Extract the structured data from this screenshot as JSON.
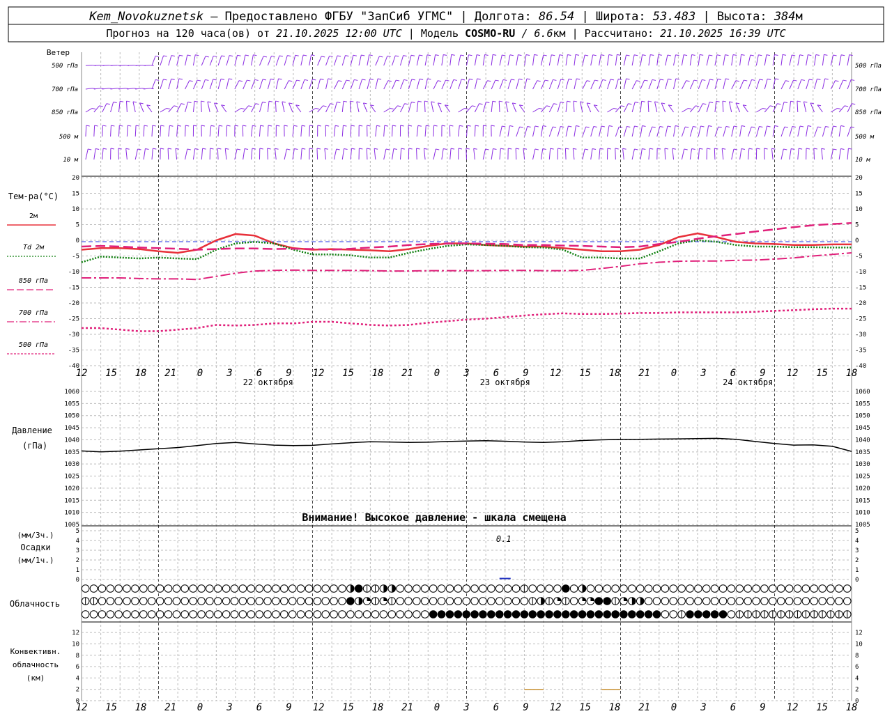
{
  "header": {
    "line1": {
      "station": "Kem_Novokuznetsk",
      "provider": " — Предоставлено ФГБУ \"ЗапСиб УГМС\" | Долгота: ",
      "lon": "86.54",
      "lat_label": " | Широта: ",
      "lat": "53.483",
      "alt_label": " | Высота: ",
      "alt": "384",
      "alt_unit": "м"
    },
    "line2": {
      "forecast": "Прогноз на 120 часа(ов) от ",
      "start": "21.10.2025 12:00 UTC",
      "model_label": " | Модель ",
      "model": "COSMO-RU",
      "res": " / 6.6",
      "res_unit": "км",
      "calc_label": " | Рассчитано: ",
      "calc": "21.10.2025 16:39 UTC"
    }
  },
  "wind_panel": {
    "title": "Ветер",
    "levels": [
      "500 гПа",
      "700 гПа",
      "850 гПа",
      "500 м",
      "10  м"
    ],
    "colors": {
      "barb": "#8a2be2"
    }
  },
  "temp_panel": {
    "title": "Тем-ра(°C)",
    "legend": [
      {
        "label": "2м",
        "color": "#e8303a",
        "style": "solid"
      },
      {
        "label": "Td  2м",
        "color": "#108010",
        "style": "dot"
      },
      {
        "label": "850 гПа",
        "color": "#e0207a",
        "style": "dash"
      },
      {
        "label": "700 гПа",
        "color": "#e0207a",
        "style": "dashdot"
      },
      {
        "label": "500 гПа",
        "color": "#e0207a",
        "style": "fine"
      }
    ],
    "ticks": [
      "20",
      "15",
      "10",
      "5",
      "0",
      "-5",
      "-10",
      "-15",
      "-20",
      "-25",
      "-30",
      "-35",
      "-40"
    ]
  },
  "time_axis": {
    "hours": [
      "12",
      "15",
      "18",
      "21",
      "0",
      "3",
      "6",
      "9",
      "12",
      "15",
      "18",
      "21",
      "0",
      "3",
      "6",
      "9",
      "12",
      "15",
      "18",
      "21",
      "0",
      "3",
      "6",
      "9",
      "12",
      "15",
      "18"
    ],
    "dates": [
      "22 октября",
      "23 октября",
      "24 октября"
    ]
  },
  "pressure_panel": {
    "title": "Давление",
    "unit": "(гПа)",
    "ticks": [
      "1060",
      "1055",
      "1050",
      "1045",
      "1040",
      "1035",
      "1030",
      "1025",
      "1020",
      "1015",
      "1010",
      "1005"
    ],
    "warning": "Внимание! Высокое давление - шкала смещена"
  },
  "precip_panel": {
    "unit3": "(мм/3ч.)",
    "title": "Осадки",
    "unit1": "(мм/1ч.)",
    "ticks": [
      "5",
      "4",
      "3",
      "2",
      "1",
      "0"
    ],
    "annotation": "0.1"
  },
  "cloud_panel": {
    "title": "Облачность",
    "rows": [
      "00000000000000000000000000000000341133000000000000000100004030000000000000000000000000000000000000000000000000000000000000000001023",
      "11000000000000000000000000000000432121000000000000000013121022441233000000000000000000000000000000000000000000000000000000001111110",
      "00000000000000000000000000000000000000000044444444444444444444444444440014444401111111111111111111111111111111111111111111111111144441"
    ]
  },
  "conv_panel": {
    "title1": "Конвективн.",
    "title2": "облачность",
    "unit": "(км)",
    "ticks": [
      "12",
      "10",
      "8",
      "6",
      "4",
      "2",
      "0"
    ]
  },
  "chart_data": [
    {
      "type": "line",
      "title": "Тем-ра(°C)",
      "x_hours": [
        0,
        3,
        6,
        9,
        12,
        15,
        18,
        21,
        24,
        27,
        30,
        33,
        36,
        39,
        42,
        45,
        48,
        51,
        54,
        57,
        60,
        63,
        66,
        69,
        72,
        75,
        78,
        81,
        84,
        87,
        90,
        93,
        96,
        99,
        102,
        105,
        108,
        111,
        114,
        117,
        120
      ],
      "ylim": [
        -40,
        20
      ],
      "series": [
        {
          "name": "2м",
          "values": [
            -3,
            -2.5,
            -2.5,
            -2.8,
            -3.5,
            -4,
            -3,
            0,
            2,
            1.5,
            -1,
            -2.5,
            -3,
            -2.8,
            -3,
            -3.2,
            -3.5,
            -2.8,
            -1.8,
            -1,
            -1,
            -1.5,
            -1.8,
            -2,
            -2,
            -2.5,
            -3,
            -3.5,
            -3.5,
            -3,
            -1.5,
            1,
            2.2,
            1,
            -0.5,
            -1,
            -1.2,
            -1.5,
            -1.5,
            -1.3,
            -1.3
          ]
        },
        {
          "name": "Td 2м",
          "values": [
            -7,
            -5.2,
            -5.5,
            -5.8,
            -5.5,
            -5.8,
            -6,
            -3,
            -1,
            -0.5,
            -1,
            -3,
            -4.5,
            -4.5,
            -4.8,
            -5.5,
            -5.5,
            -4,
            -2.8,
            -1.8,
            -1.3,
            -1.5,
            -1.8,
            -2.2,
            -2.3,
            -3,
            -5.5,
            -5.5,
            -5.8,
            -5.8,
            -3.5,
            -1,
            0,
            -0.5,
            -1.5,
            -2,
            -2,
            -2.2,
            -2.2,
            -2.3,
            -2.3
          ]
        },
        {
          "name": "850 гПа",
          "values": [
            -2,
            -1.8,
            -2,
            -2.3,
            -2.5,
            -2.7,
            -3,
            -2.8,
            -2.6,
            -2.6,
            -2.8,
            -2.7,
            -2.8,
            -3,
            -2.7,
            -2.3,
            -2,
            -1.5,
            -1.2,
            -1,
            -1,
            -1.1,
            -1.2,
            -1.5,
            -1.5,
            -1.7,
            -1.8,
            -2,
            -2.2,
            -2,
            -1.2,
            -0.5,
            0.5,
            1.3,
            2,
            2.8,
            3.5,
            4.2,
            4.8,
            5.2,
            5.5
          ]
        },
        {
          "name": "700 гПа",
          "values": [
            -12,
            -12,
            -12,
            -12.2,
            -12.3,
            -12.3,
            -12.5,
            -11.5,
            -10.5,
            -9.8,
            -9.6,
            -9.5,
            -9.6,
            -9.6,
            -9.6,
            -9.7,
            -9.8,
            -9.8,
            -9.7,
            -9.7,
            -9.7,
            -9.7,
            -9.6,
            -9.6,
            -9.7,
            -9.7,
            -9.6,
            -9,
            -8.3,
            -7.5,
            -7,
            -6.7,
            -6.6,
            -6.6,
            -6.4,
            -6.3,
            -6,
            -5.6,
            -5,
            -4.5,
            -4
          ]
        },
        {
          "name": "500 гПа",
          "values": [
            -28,
            -28,
            -28.5,
            -29,
            -29,
            -28.5,
            -28,
            -27,
            -27.2,
            -27,
            -26.5,
            -26.5,
            -26,
            -26,
            -26.5,
            -27,
            -27.2,
            -27,
            -26.3,
            -25.8,
            -25.3,
            -25,
            -24.5,
            -24,
            -23.6,
            -23.3,
            -23.5,
            -23.5,
            -23.4,
            -23.2,
            -23.2,
            -23,
            -23,
            -23,
            -23,
            -22.8,
            -22.5,
            -22.3,
            -22,
            -21.8,
            -21.8
          ]
        }
      ]
    },
    {
      "type": "line",
      "title": "Давление",
      "x_hours": [
        0,
        3,
        6,
        9,
        12,
        15,
        18,
        21,
        24,
        27,
        30,
        33,
        36,
        39,
        42,
        45,
        48,
        51,
        54,
        57,
        60,
        63,
        66,
        69,
        72,
        75,
        78,
        81,
        84,
        87,
        90,
        93,
        96,
        99,
        102,
        105,
        108,
        111,
        114,
        117,
        120
      ],
      "ylim": [
        1005,
        1060
      ],
      "series": [
        {
          "name": "Давление",
          "values": [
            1035.4,
            1035,
            1035.3,
            1035.8,
            1036.3,
            1036.8,
            1037.6,
            1038.5,
            1038.9,
            1038.3,
            1037.8,
            1037.6,
            1037.7,
            1038.3,
            1038.8,
            1039.2,
            1039.1,
            1038.9,
            1039,
            1039.3,
            1039.5,
            1039.6,
            1039.4,
            1039.1,
            1038.9,
            1039.2,
            1039.7,
            1040,
            1040.2,
            1040.2,
            1040.3,
            1040.4,
            1040.5,
            1040.6,
            1040.2,
            1039.3,
            1038.5,
            1037.8,
            1037.9,
            1037.3,
            1035.2
          ]
        }
      ]
    },
    {
      "type": "bar",
      "title": "Осадки",
      "x_hours": [
        66
      ],
      "values": [
        0.1
      ],
      "ylim": [
        0,
        5
      ]
    },
    {
      "type": "bar",
      "title": "Конвективн. облачность",
      "series": [
        {
          "name": "segment",
          "values": [
            [
              69,
              72,
              1
            ],
            [
              81,
              84,
              1
            ]
          ]
        }
      ],
      "ylim": [
        0,
        13
      ]
    }
  ]
}
